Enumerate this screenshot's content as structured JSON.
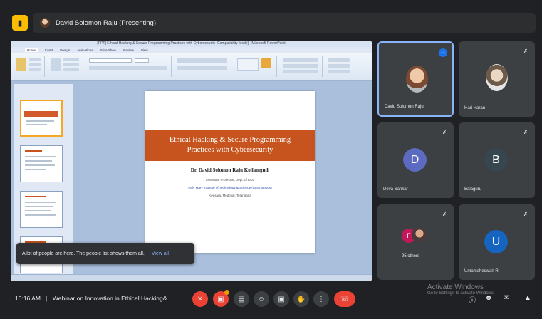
{
  "meeting": {
    "presenter_label": "David Solomon Raju (Presenting)",
    "time": "10:16 AM",
    "separator": "|",
    "title": "Webinar on Innovation in Ethical Hacking&..."
  },
  "screen_share": {
    "window_title": "[PPT] Ethical Hacking & Secure Programming Practices with Cybersecurity [Compatibility Mode] - Microsoft PowerPoint",
    "tabs": [
      "Home",
      "Insert",
      "Design",
      "Animations",
      "Slide Show",
      "Review",
      "View"
    ],
    "slide": {
      "title": "Ethical Hacking & Secure Programming Practices with Cybersecurity",
      "author": "Dr. David Solomon Raju Kollamgudi",
      "role": "Associate Professor, Dept. of ECE",
      "institute": "Holy Mary Institute of Technology & Science (Autonomous)",
      "location": "Keesara, Medchal, Telangana"
    }
  },
  "toast": {
    "message": "A lot of people are here. The people list shows them all.",
    "action": "View all"
  },
  "participants": [
    {
      "name": "David Solomon Raju",
      "type": "photo",
      "speaking": true
    },
    {
      "name": "Hari Haran",
      "type": "photo",
      "muted": true
    },
    {
      "name": "Deva Sankar",
      "type": "letter",
      "letter": "D",
      "color": "#5c6bc0",
      "muted": true
    },
    {
      "name": "Balaguru",
      "type": "letter",
      "letter": "B",
      "color": "#37474f",
      "muted": true
    },
    {
      "name": "95 others",
      "type": "group",
      "letter": "F",
      "muted": true
    },
    {
      "name": "Umamaheswari R",
      "type": "letter",
      "letter": "U",
      "color": "#1565c0",
      "muted": true
    }
  ],
  "watermark": {
    "title": "Activate Windows",
    "subtitle": "Go to Settings to activate Windows."
  },
  "icons": {
    "mic": "mic-off-icon",
    "camera": "camera-icon",
    "captions": "captions-icon",
    "emoji": "emoji-icon",
    "present": "present-icon",
    "hand": "raise-hand-icon",
    "more": "more-options-icon",
    "end": "end-call-icon",
    "info": "info-icon",
    "people": "people-icon",
    "chat": "chat-icon",
    "activities": "activities-icon"
  },
  "colors": {
    "background": "#202124",
    "tile": "#3c4043",
    "accent": "#8ab4f8",
    "end_call": "#ea4335",
    "slide_banner": "#c7541e"
  }
}
